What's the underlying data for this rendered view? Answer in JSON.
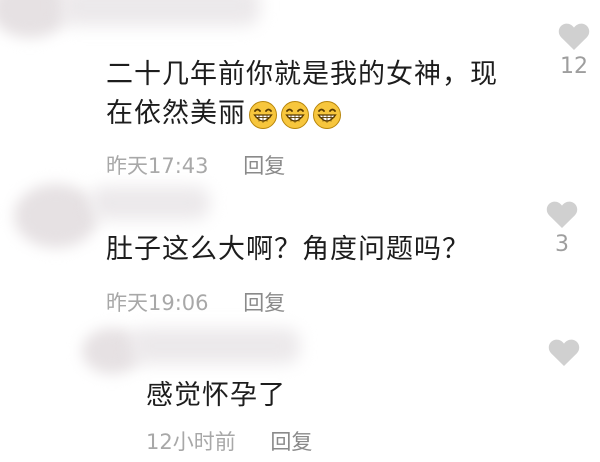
{
  "comments": [
    {
      "text_line1": "二十几年前你就是我的女神，现",
      "text_line2": "在依然美丽",
      "emojis": [
        "grin-emoji",
        "grin-emoji",
        "grin-emoji"
      ],
      "time": "昨天17:43",
      "reply_label": "回复",
      "likes": "12",
      "like_icon": "heart-icon"
    },
    {
      "text_line1": "肚子这么大啊？角度问题吗？",
      "time": "昨天19:06",
      "reply_label": "回复",
      "likes": "3",
      "like_icon": "heart-icon"
    },
    {
      "text_line1": "感觉怀孕了",
      "time": "12小时前",
      "reply_label": "回复",
      "likes": "",
      "like_icon": "heart-icon"
    }
  ],
  "colors": {
    "text": "#1d1d1d",
    "meta": "#a8a8a8",
    "heart": "#d0d0d0",
    "emoji_face": "#f7c63d"
  }
}
